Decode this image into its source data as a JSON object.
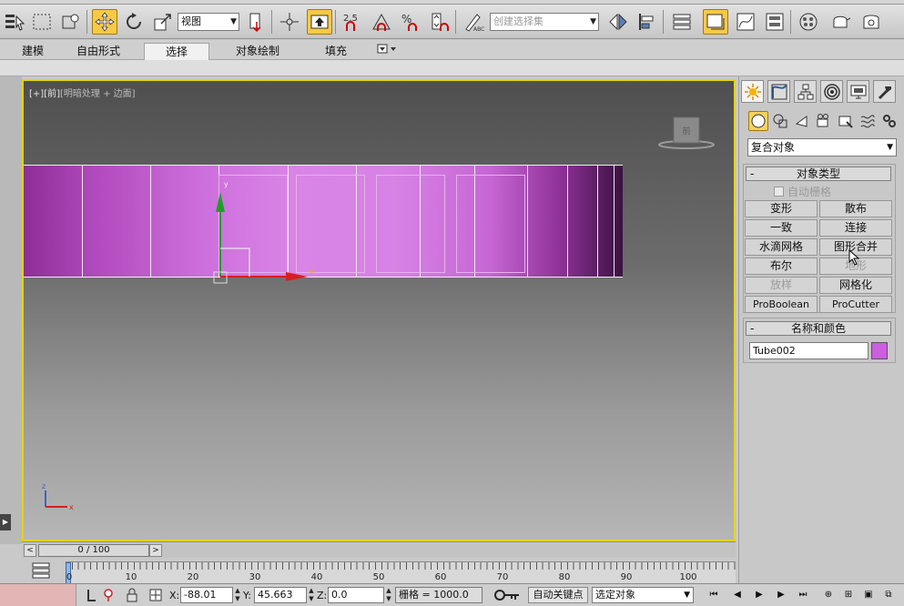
{
  "toolbar": {
    "view_combo": "视图",
    "named_selection_placeholder": "创建选择集",
    "snap_angle_label": "2.5"
  },
  "ribbon": {
    "tabs": [
      "建模",
      "自由形式",
      "选择",
      "对象绘制",
      "填充"
    ],
    "active_tab": "选择"
  },
  "viewport": {
    "label_bracket": "[+]",
    "label_view": "[前]",
    "label_shading": "[明暗处理 + 边面]",
    "viewcube_face": "前",
    "gizmo_z": "z",
    "gizmo_x": "x",
    "axis_y": "y",
    "axis_x": "x",
    "object_color": "#cc5ee0",
    "border_color": "#e6d400"
  },
  "timeslider": {
    "position": "0 / 100",
    "left_arrow": "<",
    "right_arrow": ">"
  },
  "trackbar": {
    "labels": [
      "0",
      "10",
      "20",
      "30",
      "40",
      "50",
      "60",
      "70",
      "80",
      "90",
      "100"
    ]
  },
  "statusbar": {
    "x_label": "X:",
    "x_value": "-88.01",
    "y_label": "Y:",
    "y_value": "45.663",
    "z_label": "Z:",
    "z_value": "0.0",
    "grid": "栅格 = 1000.0",
    "autokey": "自动关键点",
    "selection_mode": "选定对象"
  },
  "command_panel": {
    "type_dropdown": "复合对象",
    "object_type_header": "对象类型",
    "auto_grid": "自动栅格",
    "buttons": [
      {
        "label": "变形",
        "enabled": true
      },
      {
        "label": "散布",
        "enabled": true
      },
      {
        "label": "一致",
        "enabled": true
      },
      {
        "label": "连接",
        "enabled": true
      },
      {
        "label": "水滴网格",
        "enabled": true
      },
      {
        "label": "图形合并",
        "enabled": true
      },
      {
        "label": "布尔",
        "enabled": true
      },
      {
        "label": "地形",
        "enabled": false
      },
      {
        "label": "放样",
        "enabled": false
      },
      {
        "label": "网格化",
        "enabled": true
      },
      {
        "label": "ProBoolean",
        "enabled": true
      },
      {
        "label": "ProCutter",
        "enabled": true
      }
    ],
    "name_color_header": "名称和颜色",
    "object_name": "Tube002",
    "object_color": "#cc5ee0",
    "rollout_minus": "-"
  }
}
